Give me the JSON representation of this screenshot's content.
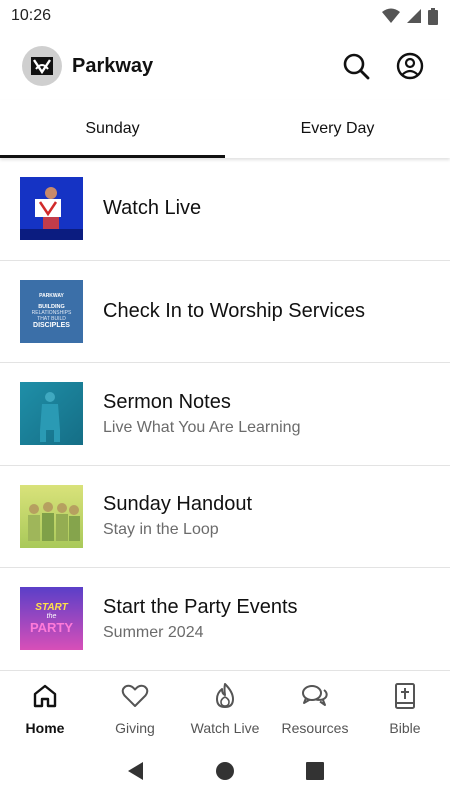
{
  "status_bar": {
    "time": "10:26"
  },
  "header": {
    "title": "Parkway",
    "icons": [
      "search-icon",
      "account-icon"
    ]
  },
  "tabs": [
    {
      "label": "Sunday",
      "active": true
    },
    {
      "label": "Every Day",
      "active": false
    }
  ],
  "items": [
    {
      "title": "Watch Live",
      "subtitle": ""
    },
    {
      "title": "Check In to Worship Services",
      "subtitle": ""
    },
    {
      "title": "Sermon Notes",
      "subtitle": "Live What You Are Learning"
    },
    {
      "title": "Sunday Handout",
      "subtitle": "Stay in the Loop"
    },
    {
      "title": "Start the Party Events",
      "subtitle": "Summer 2024"
    }
  ],
  "thumbnails": {
    "checkin": {
      "brand": "PARKWAY",
      "line1": "BUILDING",
      "line2": "RELATIONSHIPS",
      "line3": "THAT BUILD",
      "line4": "DISCIPLES"
    },
    "party": {
      "line1": "START",
      "line2": "the",
      "line3": "PARTY"
    }
  },
  "bottom_nav": [
    {
      "label": "Home",
      "icon": "home-icon",
      "active": true
    },
    {
      "label": "Giving",
      "icon": "heart-icon",
      "active": false
    },
    {
      "label": "Watch Live",
      "icon": "flame-icon",
      "active": false
    },
    {
      "label": "Resources",
      "icon": "chat-bubbles-icon",
      "active": false
    },
    {
      "label": "Bible",
      "icon": "bible-icon",
      "active": false
    }
  ],
  "colors": {
    "accent": "#111111",
    "muted": "#6b6b6b",
    "divider": "#e3e3e3"
  }
}
